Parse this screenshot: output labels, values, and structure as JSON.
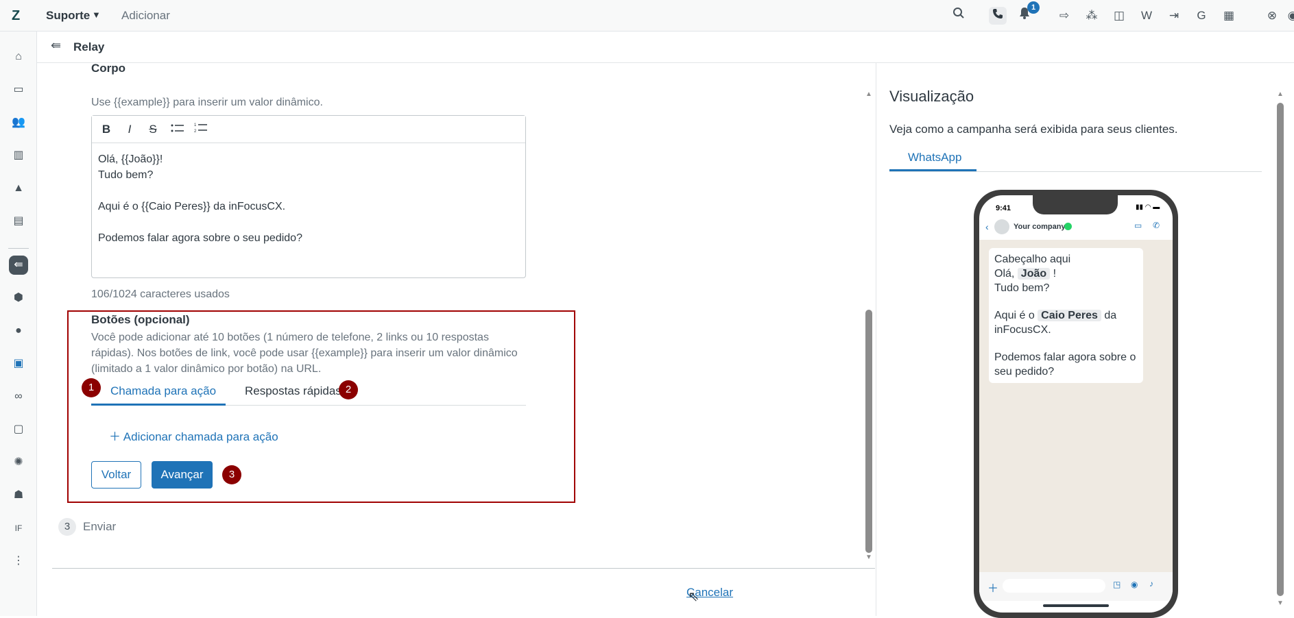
{
  "topbar": {
    "product": "Suporte",
    "add_label": "Adicionar",
    "notification_count": "1"
  },
  "sidebar": {
    "initials": "IF"
  },
  "app": {
    "title": "Relay"
  },
  "body_section": {
    "title": "Corpo",
    "help": "Use {{example}} para inserir um valor dinâmico.",
    "editor_lines": [
      "Olá, {{João}}!",
      "Tudo bem?",
      "",
      "Aqui é o {{Caio Peres}} da inFocusCX.",
      "",
      "Podemos falar agora sobre o seu pedido?"
    ],
    "char_count": "106/1024 caracteres usados"
  },
  "buttons_section": {
    "title": "Botões (opcional)",
    "help": "Você pode adicionar até 10 botões (1 número de telefone, 2 links ou 10 respostas rápidas). Nos botões de link, você pode usar {{example}} para inserir um valor dinâmico (limitado a 1 valor dinâmico por botão) na URL.",
    "tabs": [
      {
        "label": "Chamada para ação",
        "active": true,
        "marker": "1"
      },
      {
        "label": "Respostas rápidas",
        "active": false,
        "marker": "2"
      }
    ],
    "add_cta": "Adicionar chamada para ação",
    "back_label": "Voltar",
    "next_label": "Avançar",
    "next_marker": "3"
  },
  "step3": {
    "number": "3",
    "label": "Enviar"
  },
  "footer": {
    "cancel_label": "Cancelar"
  },
  "preview": {
    "title": "Visualização",
    "subtitle": "Veja como a campanha será exibida para seus clientes.",
    "tab": "WhatsApp",
    "phone_time": "9:41",
    "company": "Your company",
    "message": {
      "header": "Cabeçalho aqui",
      "greeting_prefix": "Olá,",
      "greeting_var": "João",
      "greeting_suffix": "!",
      "line2": "Tudo bem?",
      "line3_prefix": "Aqui é o",
      "line3_var": "Caio Peres",
      "line3_suffix": "da",
      "line3_cont": "inFocusCX.",
      "line4": "Podemos falar agora sobre o seu pedido?"
    }
  },
  "colors": {
    "accent": "#1f73b7",
    "highlight_border": "#a00000",
    "marker": "#8b0000"
  }
}
